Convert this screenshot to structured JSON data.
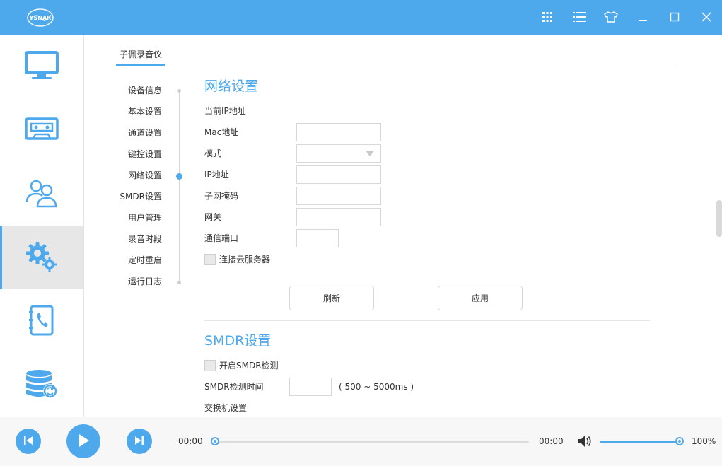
{
  "titlebar": {
    "logo_text": "YSNAR",
    "icons": [
      "grid-icon",
      "list-icon",
      "tshirt-icon",
      "minimize-icon",
      "maximize-icon",
      "close-icon"
    ]
  },
  "leftnav": {
    "items": [
      {
        "icon": "monitor-icon",
        "active": false
      },
      {
        "icon": "cassette-icon",
        "active": false
      },
      {
        "icon": "users-icon",
        "active": false
      },
      {
        "icon": "gears-icon",
        "active": true
      },
      {
        "icon": "phonebook-icon",
        "active": false
      },
      {
        "icon": "database-icon",
        "active": false
      }
    ]
  },
  "main": {
    "tab_label": "子佩录音仪",
    "subnav": [
      "设备信息",
      "基本设置",
      "通道设置",
      "键控设置",
      "网络设置",
      "SMDR设置",
      "用户管理",
      "录音时段",
      "定时重启",
      "运行日志"
    ],
    "subnav_active": "网络设置"
  },
  "network": {
    "title": "网络设置",
    "current_ip_label": "当前IP地址",
    "mac_label": "Mac地址",
    "mode_label": "模式",
    "ip_label": "IP地址",
    "subnet_label": "子网掩码",
    "gateway_label": "网关",
    "port_label": "通信端口",
    "cloud_label": "连接云服务器",
    "cloud_checked": false,
    "refresh_label": "刷新",
    "apply_label": "应用"
  },
  "smdr": {
    "title": "SMDR设置",
    "enable_label": "开启SMDR检测",
    "enable_checked": false,
    "detect_time_label": "SMDR检测时间",
    "detect_time_hint": "( 500 ~ 5000ms )",
    "switch_label": "交换机设置"
  },
  "player": {
    "current_time": "00:00",
    "total_time": "00:00",
    "progress": 0,
    "volume": 100,
    "volume_label": "100%"
  },
  "colors": {
    "accent": "#4ea9ec",
    "nav_active_bg": "#e7e7e7"
  }
}
